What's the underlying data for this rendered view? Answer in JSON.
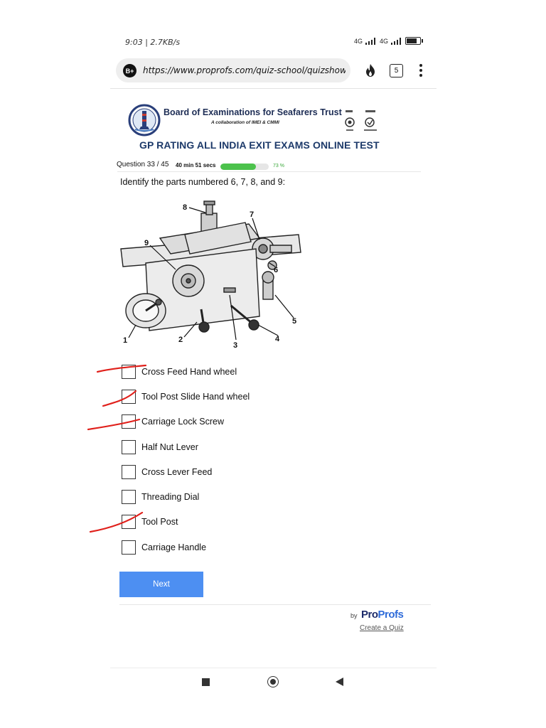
{
  "status_bar": {
    "time_speed": "9:03 | 2.7KB/s",
    "network_label_1": "4G",
    "network_label_2": "4G"
  },
  "browser": {
    "url": "https://www.proprofs.com/quiz-school/quizshow.",
    "profile_badge": "B+",
    "tab_count": "5"
  },
  "header": {
    "org_title": "Board of Examinations for Seafarers Trust",
    "org_subtitle": "A collaboration of IMEI & CMMI",
    "exam_title": "GP RATING ALL INDIA EXIT EXAMS ONLINE TEST"
  },
  "progress": {
    "question_counter": "Question 33 / 45",
    "timer": "40 min 51 secs",
    "percent_label": "73 %",
    "percent_value": 73
  },
  "question": {
    "text": "Identify the parts numbered 6, 7, 8, and 9:",
    "diagram_labels": [
      "8",
      "7",
      "9",
      "6",
      "5",
      "1",
      "2",
      "3",
      "4"
    ]
  },
  "options": [
    {
      "label": "Cross Feed Hand wheel",
      "marked": true
    },
    {
      "label": "Tool Post Slide Hand wheel",
      "marked": true
    },
    {
      "label": "Carriage Lock Screw",
      "marked": true
    },
    {
      "label": "Half Nut Lever",
      "marked": false
    },
    {
      "label": "Cross Lever Feed",
      "marked": false
    },
    {
      "label": "Threading Dial",
      "marked": false
    },
    {
      "label": "Tool Post",
      "marked": true
    },
    {
      "label": "Carriage Handle",
      "marked": false
    }
  ],
  "actions": {
    "next_label": "Next"
  },
  "footer": {
    "by_label": "by",
    "brand_part1": "Pro",
    "brand_part2": "Profs",
    "create_quiz": "Create a Quiz"
  },
  "colors": {
    "accent_button": "#4d8ff2",
    "progress_fill": "#4cc24c",
    "title_navy": "#1d3a6a",
    "annotation_red": "#e0201b"
  }
}
